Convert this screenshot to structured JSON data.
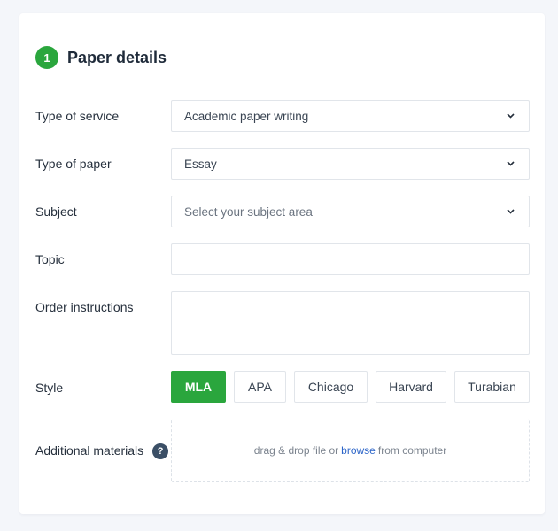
{
  "section": {
    "step_number": "1",
    "title": "Paper details"
  },
  "fields": {
    "service": {
      "label": "Type of service",
      "value": "Academic paper writing"
    },
    "paper": {
      "label": "Type of paper",
      "value": "Essay"
    },
    "subject": {
      "label": "Subject",
      "placeholder": "Select your subject area"
    },
    "topic": {
      "label": "Topic",
      "value": ""
    },
    "instructions": {
      "label": "Order instructions",
      "value": ""
    },
    "style": {
      "label": "Style",
      "options": [
        "MLA",
        "APA",
        "Chicago",
        "Harvard",
        "Turabian"
      ],
      "selected": "MLA"
    },
    "materials": {
      "label": "Additional materials",
      "help_icon": "?",
      "drop_text_before": "drag & drop file or",
      "browse_link": "browse",
      "drop_text_after": "from computer"
    }
  },
  "colors": {
    "accent": "#2aa63d",
    "link": "#2b64c8",
    "help_icon_bg": "#3b4f66"
  },
  "icons": {
    "dropdown": "chevron-down-icon",
    "help": "question-mark-icon"
  }
}
